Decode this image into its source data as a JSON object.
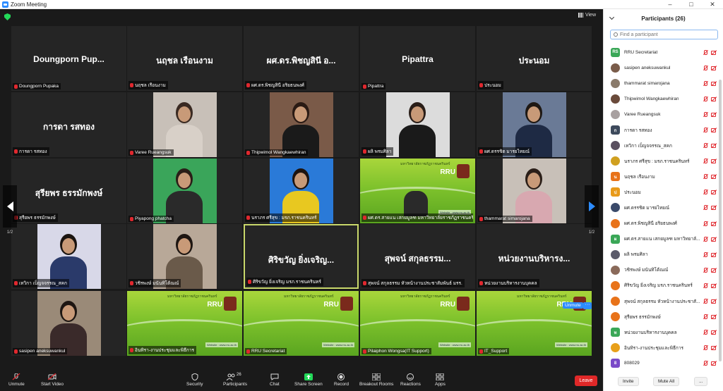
{
  "window": {
    "title": "Zoom Meeting"
  },
  "view_label": "View",
  "tiles": [
    {
      "big": "Doungporn  Pup...",
      "label": "Doungporn Pupaka"
    },
    {
      "big": "นฤชล  เรือนงาม",
      "label": "นฤชล  เรือนงาม"
    },
    {
      "big": "ผศ.ดร.พิชญสินี อ...",
      "label": "ผศ.ดร.พิชญสินี อริยธนพงศ์"
    },
    {
      "big": "Pipattra",
      "label": "Pipattra"
    },
    {
      "big": "ประนอม",
      "label": "ประนอม"
    },
    {
      "big": "การดา รสทอง",
      "label": "การดา รสทอง"
    },
    {
      "big": "",
      "label": "Varee Rueangsuk"
    },
    {
      "big": "",
      "label": "Thipwimol Wangkaewhiran"
    },
    {
      "big": "",
      "label": "ผลิ พรมศิลา"
    },
    {
      "big": "",
      "label": "ผศ.ดรรชิต มารยไทยณ์"
    },
    {
      "big": "สุรียพร ธรรมักพงษ์",
      "label": "สุรียพร ธรรมักพงษ์"
    },
    {
      "big": "",
      "label": "Piyapong phatcha"
    },
    {
      "big": "",
      "label": "นราภร ศรีสุข : มรภ.ราชนครินทร์"
    },
    {
      "big": "",
      "label": "ผศ.ดร.สายแน เสกยมูลฑ มหาวิทยาลัยราชภัฏราชนครินทร์"
    },
    {
      "big": "",
      "label": "thammarat simarojana"
    },
    {
      "big": "",
      "label": "เทวิกา เบ็ญจจรรณ_สคก"
    },
    {
      "big": "",
      "label": "วชิรพงษ์ มนันทิโต้ณณ์"
    },
    {
      "big": "ศิริขวัญ  ยิ่งเจริญ...",
      "label": "ศิริขวัญ  ยิ่งเจริญ  มรภ.ราชนครินทร์"
    },
    {
      "big": "สุพจน์ สกุลธรรม...",
      "label": "สุพจน์ สกุลธรรม หัวหน้างานประชาสัมพันธ์ มรร."
    },
    {
      "big": "หน่วยงานบริหารง...",
      "label": "หน่วยงานบริหารงานบุคคล"
    },
    {
      "big": "",
      "label": "sasipen aneksuwankul"
    },
    {
      "big": "",
      "label": "อินทิรา-งานประชุมและพิธีการ"
    },
    {
      "big": "",
      "label": "RRU Secretariat"
    },
    {
      "big": "",
      "label": "Pilaiphon Wongsa(IT Support)"
    },
    {
      "big": "",
      "label": "IT_Support"
    }
  ],
  "slide": {
    "brand": "RRU",
    "title": "มหาวิทยาลัยราชภัฏราชนครินทร์",
    "website": "Website : www.rru.ac.th"
  },
  "pagination": {
    "left": "1/2",
    "right": "1/2"
  },
  "tile_tags": {
    "unmute": "Unmute",
    "more": "···"
  },
  "toolbar": {
    "unmute": "Unmute",
    "start_video": "Start Video",
    "security": "Security",
    "participants": "Participants",
    "participants_count": "26",
    "chat": "Chat",
    "share_screen": "Share Screen",
    "record": "Record",
    "breakout_rooms": "Breakout Rooms",
    "reactions": "Reactions",
    "apps": "Apps",
    "leave": "Leave"
  },
  "panel": {
    "title": "Participants (26)",
    "search_placeholder": "Find a participant",
    "invite": "Invite",
    "mute_all": "Mute All",
    "more": "...",
    "participants": [
      {
        "name": "RRU Secretariat",
        "initials": "RS",
        "color": "#3aa757"
      },
      {
        "name": "sasipen aneksuwankul",
        "initials": "",
        "color": "#7a5c4a"
      },
      {
        "name": "thammarat simarojana",
        "initials": "",
        "color": "#8a7a6a"
      },
      {
        "name": "Thipwimol Wangkaewhiran",
        "initials": "",
        "color": "#6a4a3a"
      },
      {
        "name": "Varee Rueangsuk",
        "initials": "",
        "color": "#a8a0a0"
      },
      {
        "name": "การดา รสทอง",
        "initials": "ก",
        "color": "#3d4a5c"
      },
      {
        "name": "เทวิกา เบ็ญจจรรณ_สคก",
        "initials": "",
        "color": "#5a5060"
      },
      {
        "name": "นราภร ศรีสุข : มรภ.ราชนครินทร์",
        "initials": "",
        "color": "#d0a020"
      },
      {
        "name": "นฤชล  เรือนงาม",
        "initials": "น",
        "color": "#e8731a"
      },
      {
        "name": "ประนอม",
        "initials": "ป",
        "color": "#e89a1a"
      },
      {
        "name": "ผศ.ดรรชิต มารยไทยณ์",
        "initials": "",
        "color": "#3a4a6a"
      },
      {
        "name": "ผศ.ดร.พิชญสินี อริยธนพงศ์",
        "initials": "",
        "color": "#e8731a"
      },
      {
        "name": "ผศ.ดร.สายแน เสกยมูลฑ มหาวิทยาลั...",
        "initials": "ผ",
        "color": "#3aa757"
      },
      {
        "name": "ผลิ พรมศิลา",
        "initials": "",
        "color": "#5a5a6a"
      },
      {
        "name": "วชิรพงษ์ มนันทิโต้ณณ์",
        "initials": "",
        "color": "#8a6a5a"
      },
      {
        "name": "ศิริขวัญ  ยิ่งเจริญ  มรภ.ราชนครินทร์",
        "initials": "",
        "color": "#e8731a"
      },
      {
        "name": "สุพจน์ สกุลธรรม หัวหน้างานประชาสั...",
        "initials": "",
        "color": "#e8731a"
      },
      {
        "name": "สุรียพร ธรรมักพงษ์",
        "initials": "",
        "color": "#e8731a"
      },
      {
        "name": "หน่วยงานบริหารงานบุคคล",
        "initials": "ห",
        "color": "#3aa757"
      },
      {
        "name": "อินทิรา-งานประชุมและพิธีการ",
        "initials": "",
        "color": "#e8a01a"
      },
      {
        "name": "808029",
        "initials": "8",
        "color": "#7a4ac8"
      }
    ]
  },
  "colors": {
    "accent": "#2d8cff",
    "leave": "#e02828",
    "active_border": "#c9d86b",
    "share": "#23d959"
  }
}
